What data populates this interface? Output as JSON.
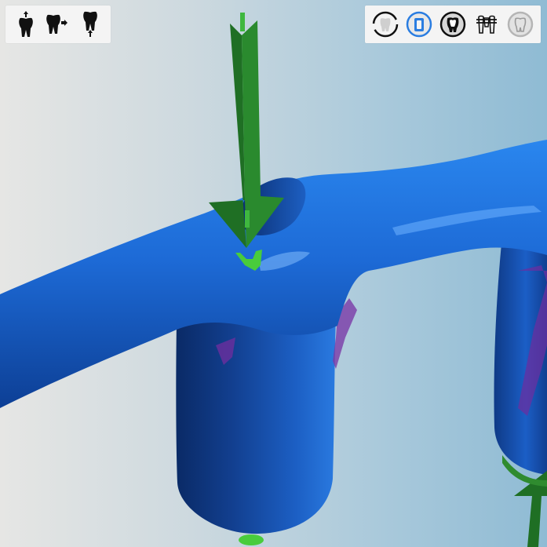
{
  "viewport": {
    "model_color": "#1f6fd8",
    "model_dark_color": "#0a2f6e",
    "arrow_color": "#2a7d2a",
    "contact_color": "#49cc3c",
    "undercut_color": "#7a3aa8"
  },
  "left_toolbar": {
    "tools": [
      {
        "name": "insertion-from-top-icon"
      },
      {
        "name": "insertion-from-side-icon"
      },
      {
        "name": "insertion-from-bottom-icon"
      }
    ]
  },
  "right_toolbar": {
    "tools": [
      {
        "name": "tooth-outline-view-icon",
        "accent": "#111111"
      },
      {
        "name": "tooth-blue-view-icon",
        "accent": "#2a7de1"
      },
      {
        "name": "tooth-dark-view-icon",
        "accent": "#111111"
      },
      {
        "name": "bridge-view-icon",
        "accent": "#111111"
      },
      {
        "name": "tooth-grey-view-icon",
        "accent": "#9a9a9a"
      }
    ]
  }
}
